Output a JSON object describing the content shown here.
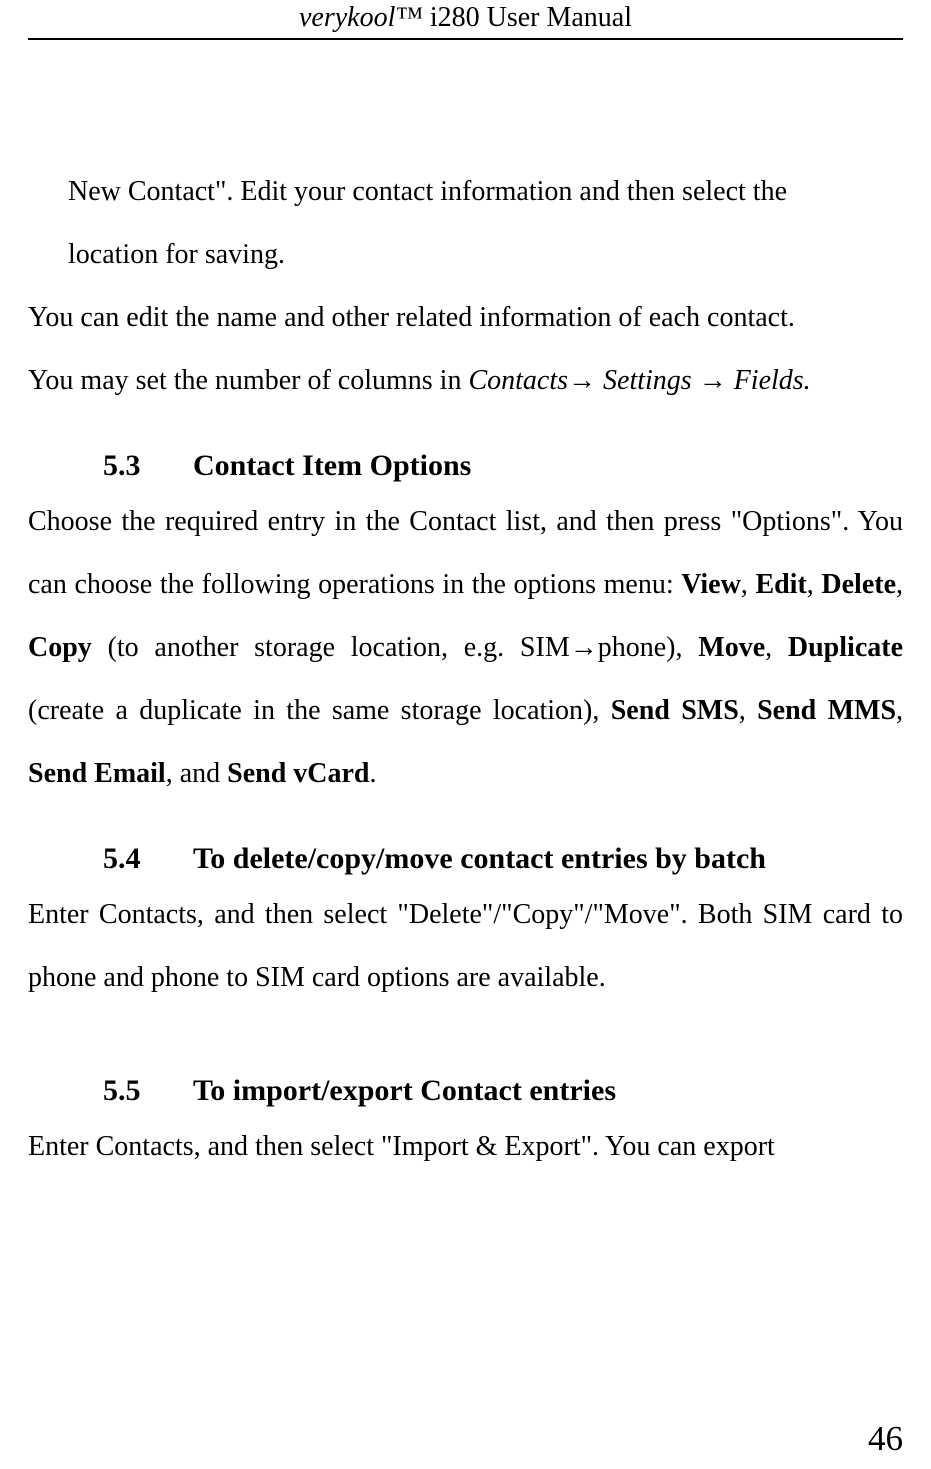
{
  "header": {
    "italic": "verykool™",
    "rest": " i280 User Manual"
  },
  "p1": {
    "line1": "New Contact\". Edit your contact information and then select the",
    "line2": "location for saving."
  },
  "p2": "You can edit the name and other related information of each contact.",
  "p3": {
    "a": "You may set the number of columns in ",
    "b": "Contacts",
    "arrow1": "→",
    "c": " Settings ",
    "arrow2": "→",
    "d": "Fields."
  },
  "h53": {
    "num": "5.3",
    "title": "Contact Item Options"
  },
  "p4": {
    "a": "Choose the required entry in the Contact list, and then press \"Options\". You can choose the following operations in the options menu: ",
    "view": "View",
    "c1": ", ",
    "edit": "Edit",
    "c2": ", ",
    "delete": "Delete",
    "c3": ", ",
    "copy": "Copy",
    "d": " (to another storage location, e.g. SIM",
    "arrow": "→",
    "e": "phone), ",
    "move": "Move",
    "c4": ", ",
    "dup": "Duplicate",
    "f": " (create a duplicate in the same storage location), ",
    "sms": "Send SMS",
    "c5": ", ",
    "mms": "Send MMS",
    "c6": ", ",
    "email": "Send Email",
    "g": ", and ",
    "vcard": "Send vCard",
    "h": "."
  },
  "h54": {
    "num": "5.4",
    "title": "To delete/copy/move contact entries by batch"
  },
  "p5": "Enter Contacts, and then select \"Delete\"/\"Copy\"/\"Move\". Both SIM card to phone and phone to SIM card options are available.",
  "h55": {
    "num": "5.5",
    "title": "To import/export Contact entries"
  },
  "p6": "Enter Contacts, and then select \"Import & Export\". You can export",
  "page": "46"
}
